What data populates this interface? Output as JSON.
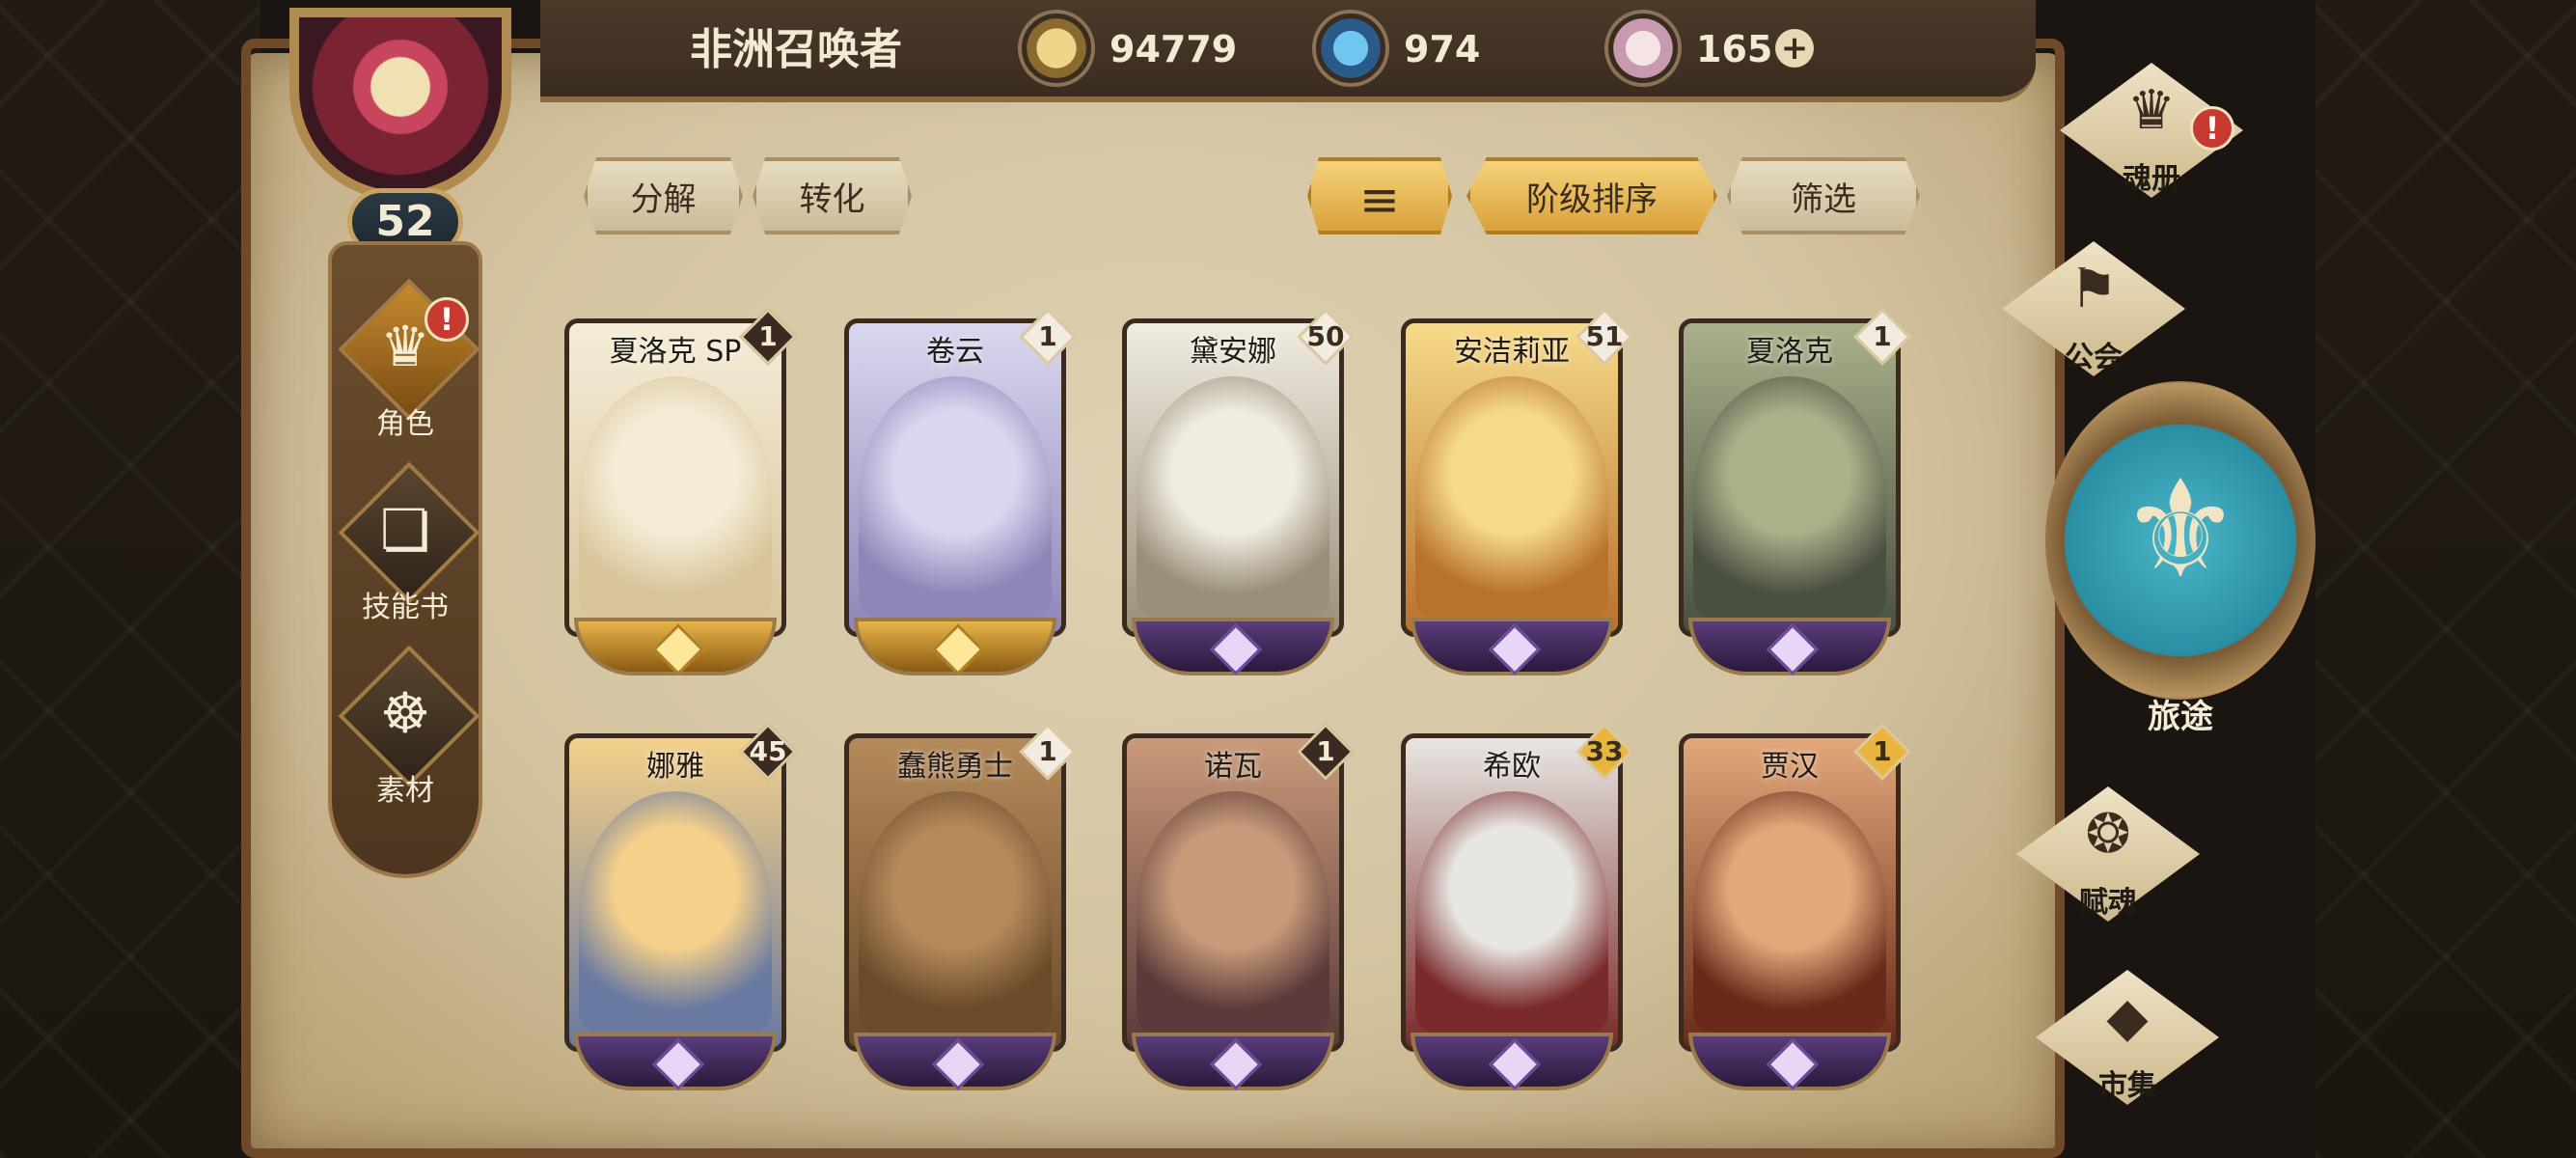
{
  "player": {
    "name": "非洲召唤者",
    "level": "52"
  },
  "currencies": [
    {
      "icon": "gold-coin-icon",
      "value": "94779"
    },
    {
      "icon": "blue-crystal-icon",
      "value": "974"
    },
    {
      "icon": "pink-gem-icon",
      "value": "165"
    }
  ],
  "plus_label": "+",
  "left_nav": [
    {
      "label": "角色",
      "icon": "character-icon",
      "glyph": "♛"
    },
    {
      "label": "技能书",
      "icon": "skill-book-icon",
      "glyph": "❏"
    },
    {
      "label": "素材",
      "icon": "material-icon",
      "glyph": "☸"
    }
  ],
  "alert_mark": "!",
  "toolbar": {
    "decompose": "分解",
    "convert": "转化",
    "sort_icon": "≡",
    "sort_by_tier": "阶级排序",
    "filter": "筛选"
  },
  "cards": [
    {
      "name": "夏洛克 SP",
      "level": "1",
      "level_style": "dark",
      "base": "gold",
      "art": [
        "#f5ecd8",
        "#d8c49a"
      ]
    },
    {
      "name": "卷云",
      "level": "1",
      "level_style": "light",
      "base": "gold",
      "art": [
        "#d9d7ef",
        "#8f86b8"
      ]
    },
    {
      "name": "黛安娜",
      "level": "50",
      "level_style": "light",
      "base": "purple",
      "art": [
        "#f0ece0",
        "#9a8f7a"
      ]
    },
    {
      "name": "安洁莉亚",
      "level": "51",
      "level_style": "light",
      "base": "purple",
      "art": [
        "#f6da8a",
        "#b8722a"
      ]
    },
    {
      "name": "夏洛克",
      "level": "1",
      "level_style": "light",
      "base": "purple",
      "art": [
        "#a9b08a",
        "#4a5040"
      ]
    },
    {
      "name": "娜雅",
      "level": "45",
      "level_style": "dark",
      "base": "purple",
      "art": [
        "#f4d08a",
        "#6a7aa0"
      ]
    },
    {
      "name": "蠢熊勇士",
      "level": "1",
      "level_style": "light",
      "base": "purple",
      "art": [
        "#b48a5a",
        "#6a4a2a"
      ]
    },
    {
      "name": "诺瓦",
      "level": "1",
      "level_style": "dark",
      "base": "purple",
      "art": [
        "#c99a7a",
        "#5a3a3a"
      ]
    },
    {
      "name": "希欧",
      "level": "33",
      "level_style": "gold",
      "base": "purple",
      "art": [
        "#e8e6e2",
        "#7a2a2a"
      ]
    },
    {
      "name": "贾汉",
      "level": "1",
      "level_style": "gold",
      "base": "purple",
      "art": [
        "#e2a87a",
        "#6a2a1a"
      ]
    }
  ],
  "right_nav": [
    {
      "label": "魂册",
      "icon": "soul-book-icon",
      "glyph": "♛"
    },
    {
      "label": "公会",
      "icon": "guild-flag-icon",
      "glyph": "⚑"
    },
    {
      "label": "赋魂",
      "icon": "soul-flame-icon",
      "glyph": "❂"
    },
    {
      "label": "市集",
      "icon": "market-icon",
      "glyph": "◆"
    }
  ],
  "journey": {
    "label": "旅途",
    "glyph": "⚜"
  }
}
